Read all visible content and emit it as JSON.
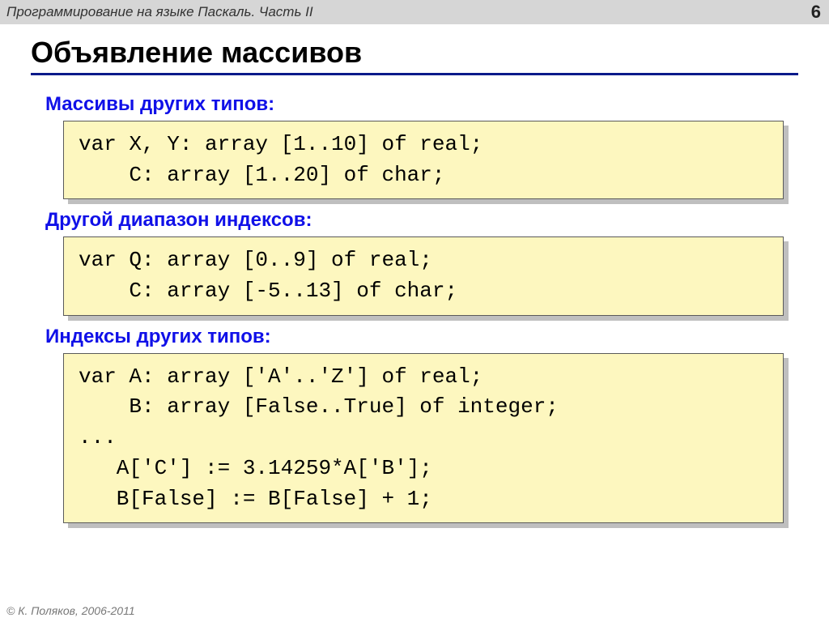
{
  "header": {
    "course_title": "Программирование на языке Паскаль. Часть II",
    "page_number": "6"
  },
  "title": "Объявление массивов",
  "sections": [
    {
      "label": "Массивы других типов:",
      "code": "var X, Y: array [1..10] of real;\n    C: array [1..20] of char;"
    },
    {
      "label": "Другой диапазон индексов:",
      "code": "var Q: array [0..9] of real;\n    C: array [-5..13] of char;"
    },
    {
      "label": "Индексы других типов:",
      "code": "var A: array ['A'..'Z'] of real;\n    B: array [False..True] of integer;\n...\n   A['C'] := 3.14259*A['B'];\n   B[False] := B[False] + 1;"
    }
  ],
  "footer": "© К. Поляков, 2006-2011"
}
